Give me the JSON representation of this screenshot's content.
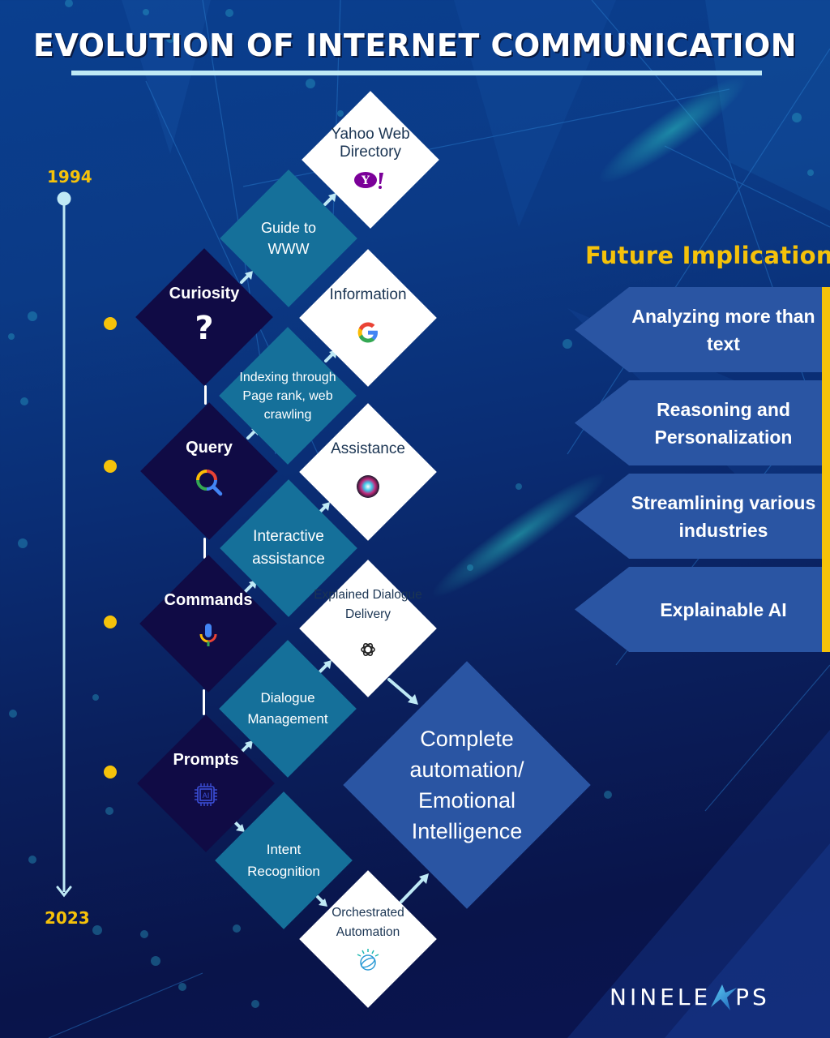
{
  "title": "EVOLUTION OF INTERNET COMMUNICATION",
  "colors": {
    "accent_yellow": "#f5c20a",
    "stage_dark": "#100b45",
    "process_teal": "#15709a",
    "outcome_white": "#ffffff",
    "future_blue": "#2a55a3",
    "arrow_light": "#bfe9f5"
  },
  "timeline": {
    "start_year": "1994",
    "end_year": "2023"
  },
  "stages": [
    {
      "label": "Curiosity",
      "icon": "question-mark-icon",
      "glyph": "?"
    },
    {
      "label": "Query",
      "icon": "search-icon"
    },
    {
      "label": "Commands",
      "icon": "microphone-icon"
    },
    {
      "label": "Prompts",
      "icon": "ai-chip-icon"
    }
  ],
  "processes": [
    {
      "label": "Guide to WWW"
    },
    {
      "label": "Indexing through Page rank, web crawling"
    },
    {
      "label": "Interactive assistance"
    },
    {
      "label": "Dialogue Management"
    },
    {
      "label": "Intent Recognition"
    }
  ],
  "outcomes": [
    {
      "label": "Yahoo Web Directory",
      "icon": "yahoo-logo-icon",
      "glyph": "Y!"
    },
    {
      "label": "Information",
      "icon": "google-logo-icon",
      "glyph": "G"
    },
    {
      "label": "Assistance",
      "icon": "siri-orb-icon"
    },
    {
      "label": "Explained Dialogue Delivery",
      "icon": "openai-logo-icon"
    },
    {
      "label": "Orchestrated Automation",
      "icon": "ibm-watson-icon"
    }
  ],
  "final": {
    "label": "Complete automation/ Emotional Intelligence"
  },
  "future": {
    "title": "Future Implications",
    "items": [
      {
        "label": "Analyzing more than text"
      },
      {
        "label": "Reasoning and Personalization"
      },
      {
        "label": "Streamlining various industries"
      },
      {
        "label": "Explainable AI"
      }
    ]
  },
  "brand": {
    "name_left": "NINELE",
    "name_right": "PS"
  }
}
